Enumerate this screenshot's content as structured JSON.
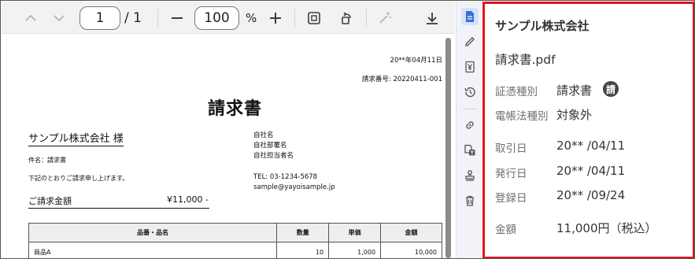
{
  "toolbar": {
    "page_current": "1",
    "page_total": "/ 1",
    "zoom": "100",
    "zoom_unit": "%"
  },
  "document": {
    "date": "20**年04月11日",
    "number": "請求番号: 20220411-001",
    "heading": "請求書",
    "client": "サンプル株式会社 様",
    "subject": "件名：請求書",
    "message": "下記のとおりご請求申し上げます。",
    "amount_label": "ご請求金額",
    "amount_value": "¥11,000 -",
    "issuer_lines": [
      "自社名",
      "自社部署名",
      "自社担当者名"
    ],
    "tel": "TEL: 03-1234-5678",
    "email": "sample@yayoisample.jp",
    "table": {
      "headers": [
        "品番・品名",
        "数量",
        "単価",
        "金額"
      ],
      "rows": [
        [
          "商品A",
          "10",
          "1,000",
          "10,000"
        ]
      ]
    }
  },
  "rail": {
    "icons": [
      "document-icon",
      "pencil-icon",
      "yen-icon",
      "history-icon",
      "link-icon",
      "document-yen-icon",
      "stamp-icon",
      "trash-icon"
    ]
  },
  "panel": {
    "company": "サンプル株式会社",
    "filename": "請求書.pdf",
    "doc_type_label": "証憑種別",
    "doc_type_value": "請求書",
    "doc_type_badge": "請",
    "law_label": "電帳法種別",
    "law_value": "対象外",
    "trade_date_label": "取引日",
    "trade_date_value": "20** /04/11",
    "issue_date_label": "発行日",
    "issue_date_value": "20** /04/11",
    "reg_date_label": "登録日",
    "reg_date_value": "20** /09/24",
    "amount_label": "金額",
    "amount_value": "11,000円（税込）"
  },
  "colors": {
    "panel_border": "#e2141f",
    "rail_active_bg": "#d6e2fb",
    "rail_active_icon": "#3a6fd8",
    "toolbar_bg": "#f2f2f4"
  }
}
